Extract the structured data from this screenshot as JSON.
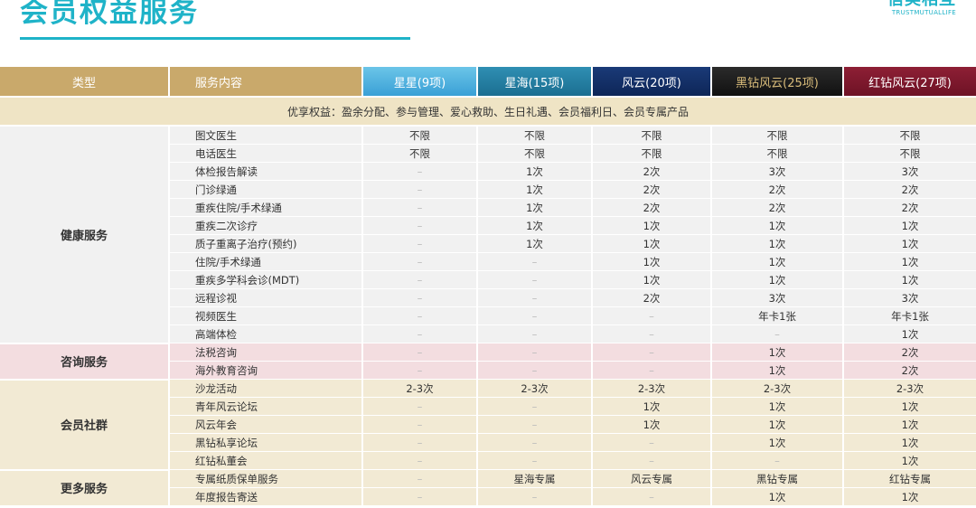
{
  "header": {
    "title": "会员权益服务",
    "brand_name": "信美相互",
    "brand_en": "TRUSTMUTUALLIFE"
  },
  "table": {
    "headers": {
      "type": "类型",
      "content": "服务内容",
      "tiers": [
        "星星(9项)",
        "星海(15项)",
        "风云(20项)",
        "黑钻风云(25项)",
        "红钻风云(27项)"
      ]
    },
    "privilege_row": "优享权益：盈余分配、参与管理、爱心救助、生日礼遇、会员福利日、会员专属产品",
    "groups": [
      {
        "name": "健康服务",
        "rows": [
          {
            "item": "图文医生",
            "values": [
              "不限",
              "不限",
              "不限",
              "不限",
              "不限"
            ]
          },
          {
            "item": "电话医生",
            "values": [
              "不限",
              "不限",
              "不限",
              "不限",
              "不限"
            ]
          },
          {
            "item": "体检报告解读",
            "values": [
              "–",
              "1次",
              "2次",
              "3次",
              "3次"
            ]
          },
          {
            "item": "门诊绿通",
            "values": [
              "–",
              "1次",
              "2次",
              "2次",
              "2次"
            ]
          },
          {
            "item": "重疾住院/手术绿通",
            "values": [
              "–",
              "1次",
              "2次",
              "2次",
              "2次"
            ]
          },
          {
            "item": "重疾二次诊疗",
            "values": [
              "–",
              "1次",
              "1次",
              "1次",
              "1次"
            ]
          },
          {
            "item": "质子重离子治疗(预约)",
            "values": [
              "–",
              "1次",
              "1次",
              "1次",
              "1次"
            ]
          },
          {
            "item": "住院/手术绿通",
            "values": [
              "–",
              "–",
              "1次",
              "1次",
              "1次"
            ]
          },
          {
            "item": "重疾多学科会诊(MDT)",
            "values": [
              "–",
              "–",
              "1次",
              "1次",
              "1次"
            ]
          },
          {
            "item": "远程诊视",
            "values": [
              "–",
              "–",
              "2次",
              "3次",
              "3次"
            ]
          },
          {
            "item": "视频医生",
            "values": [
              "–",
              "–",
              "–",
              "年卡1张",
              "年卡1张"
            ]
          },
          {
            "item": "高端体检",
            "values": [
              "–",
              "–",
              "–",
              "–",
              "1次"
            ]
          }
        ]
      },
      {
        "name": "咨询服务",
        "rows": [
          {
            "item": "法税咨询",
            "values": [
              "–",
              "–",
              "–",
              "1次",
              "2次"
            ]
          },
          {
            "item": "海外教育咨询",
            "values": [
              "–",
              "–",
              "–",
              "1次",
              "2次"
            ]
          }
        ]
      },
      {
        "name": "会员社群",
        "rows": [
          {
            "item": "沙龙活动",
            "values": [
              "2-3次",
              "2-3次",
              "2-3次",
              "2-3次",
              "2-3次"
            ]
          },
          {
            "item": "青年风云论坛",
            "values": [
              "–",
              "–",
              "1次",
              "1次",
              "1次"
            ]
          },
          {
            "item": "风云年会",
            "values": [
              "–",
              "–",
              "1次",
              "1次",
              "1次"
            ]
          },
          {
            "item": "黑钻私享论坛",
            "values": [
              "–",
              "–",
              "–",
              "1次",
              "1次"
            ]
          },
          {
            "item": "红钻私董会",
            "values": [
              "–",
              "–",
              "–",
              "–",
              "1次"
            ]
          }
        ]
      },
      {
        "name": "更多服务",
        "rows": [
          {
            "item": "专属纸质保单服务",
            "values": [
              "–",
              "星海专属",
              "风云专属",
              "黑钻专属",
              "红钻专属"
            ]
          },
          {
            "item": "年度报告寄送",
            "values": [
              "–",
              "–",
              "–",
              "1次",
              "1次"
            ]
          }
        ]
      }
    ]
  }
}
